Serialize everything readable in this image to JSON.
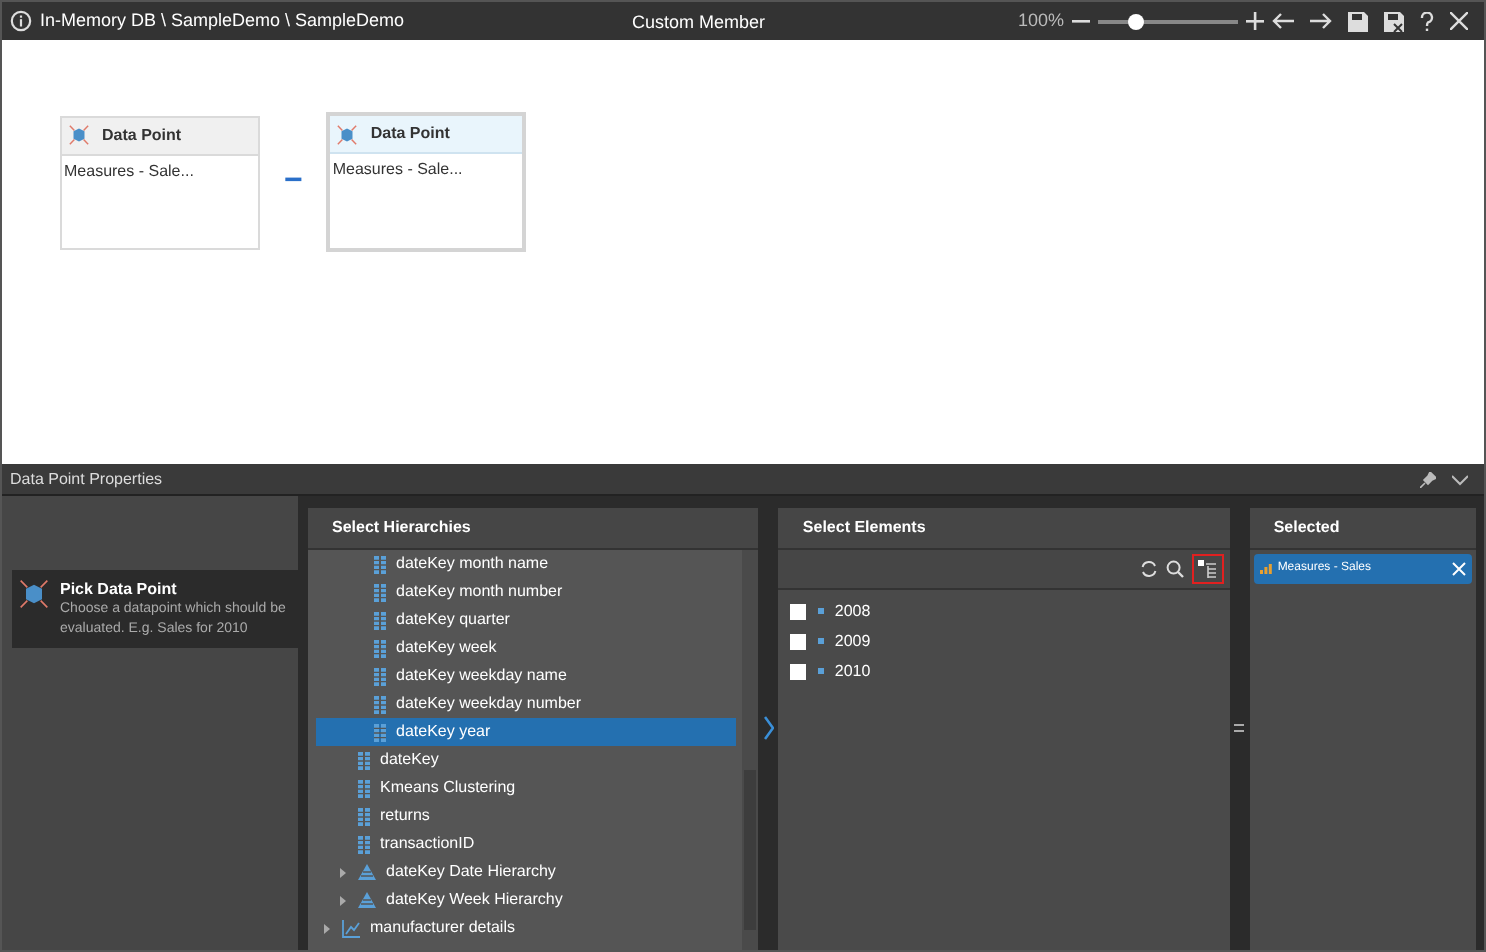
{
  "window": {
    "breadcrumb": "In-Memory DB \\ SampleDemo \\ SampleDemo",
    "title": "Custom Member",
    "zoom": {
      "reading": "100%",
      "level": 0.27
    }
  },
  "canvas": {
    "cards": [
      {
        "title": "Data Point",
        "content": "Measures - Sale...",
        "selected": false
      },
      {
        "title": "Data Point",
        "content": "Measures - Sale...",
        "selected": true
      }
    ],
    "operator": "−"
  },
  "properties": {
    "title": "Data Point Properties",
    "steps": [
      {
        "title": "Pick Data Point",
        "description": "Choose a datapoint which should be evaluated. E.g. Sales for 2010",
        "selected": true
      }
    ],
    "hierarchies": {
      "title": "Select Hierarchies",
      "tree": [
        {
          "children": [
            {
              "children": [
                {
                  "label": "dateKey month name",
                  "kind": "level",
                  "selected": false
                },
                {
                  "label": "dateKey month number",
                  "kind": "level",
                  "selected": false
                },
                {
                  "label": "dateKey quarter",
                  "kind": "level",
                  "selected": false
                },
                {
                  "label": "dateKey week",
                  "kind": "level",
                  "selected": false
                },
                {
                  "label": "dateKey weekday name",
                  "kind": "level",
                  "selected": false
                },
                {
                  "label": "dateKey weekday number",
                  "kind": "level",
                  "selected": false
                },
                {
                  "label": "dateKey year",
                  "kind": "level",
                  "selected": true
                }
              ]
            },
            {
              "label": "dateKey",
              "kind": "level",
              "selected": false
            },
            {
              "label": "Kmeans Clustering",
              "kind": "level",
              "selected": false
            },
            {
              "label": "returns",
              "kind": "level",
              "selected": false
            },
            {
              "label": "transactionID",
              "kind": "level",
              "selected": false
            },
            {
              "label": "dateKey Date Hierarchy",
              "kind": "hierarchy",
              "selected": false,
              "expanded": false
            },
            {
              "label": "dateKey Week Hierarchy",
              "kind": "hierarchy",
              "selected": false,
              "expanded": false
            }
          ]
        },
        {
          "label": "manufacturer details",
          "kind": "dimension",
          "selected": false,
          "expanded": false
        }
      ]
    },
    "elements": {
      "title": "Select Elements",
      "items": [
        {
          "label": "2008",
          "checked": false
        },
        {
          "label": "2009",
          "checked": false
        },
        {
          "label": "2010",
          "checked": false
        }
      ]
    },
    "selected": {
      "title": "Selected",
      "items": [
        {
          "label": "Measures - Sales"
        }
      ]
    }
  }
}
